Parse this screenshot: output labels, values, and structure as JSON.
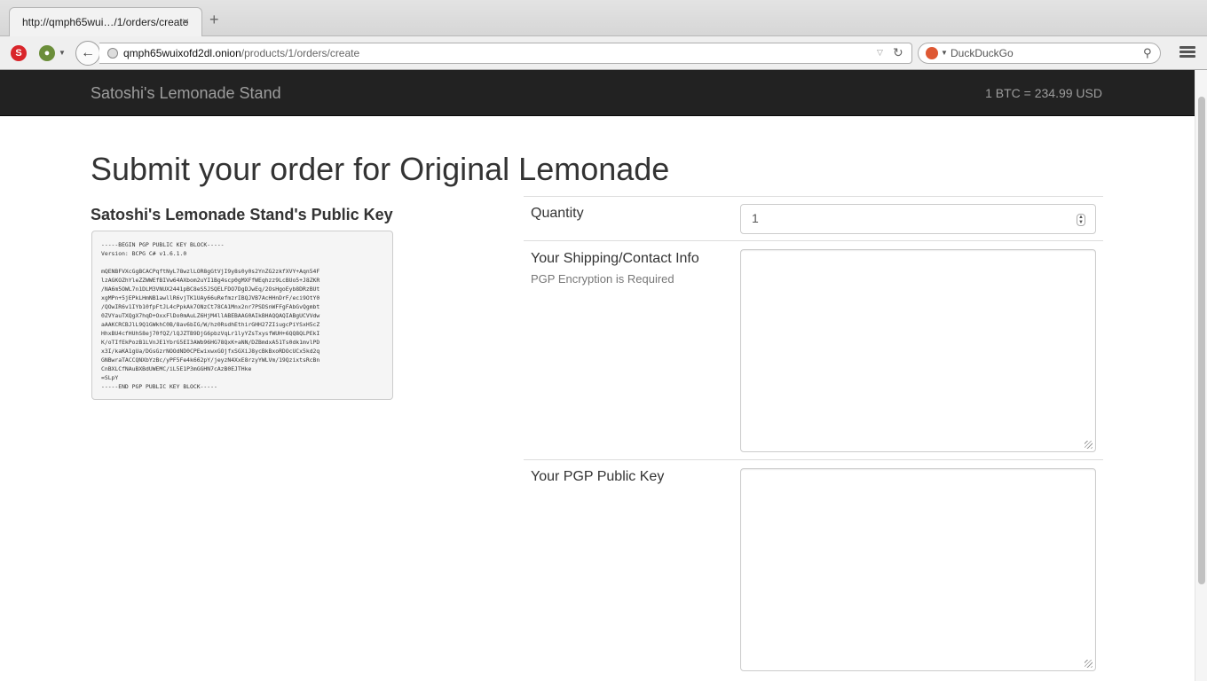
{
  "browser": {
    "tab_title": "http://qmph65wui…/1/orders/create",
    "tab_close": "×",
    "new_tab": "+",
    "url_host": "qmph65wuixofd2dl.onion",
    "url_path": "/products/1/orders/create",
    "search_engine": "DuckDuckGo",
    "reload_glyph": "↻",
    "dropdown_glyph": "▽",
    "back_glyph": "←",
    "search_glyph": "⚲"
  },
  "site": {
    "brand": "Satoshi's Lemonade Stand",
    "rate": "1 BTC = 234.99 USD"
  },
  "page": {
    "title": "Submit your order for Original Lemonade",
    "key_heading": "Satoshi's Lemonade Stand's Public Key",
    "public_key": "-----BEGIN PGP PUBLIC KEY BLOCK-----\nVersion: BCPG C# v1.6.1.0\n\nmQENBFVXcGgBCACPqftNyL78wzlLOR8gGtVjI9y8s0y0s2YnZG2zkfXVY+Aqn54F\nlzAGKOZhYleZZWWEfBIVw64AXbom2uYI1Bg4scp0gMXFfWEqhzz9LcBUo5+J8ZKR\n/NA6m5OWL7n1DLM3VNUX2441pBC8eS5JSQELFDO7DgDJwEq/2OsHgoEyb8DRzBUt\nxgMPn+5jEPkLHmNB1awllR6vjTK1UAy66uRefmzrIBQJVB7AcHHnDrF/eci9OtY0\n/QOwIR6v1IYb10fpFtJL4cPpkAk7ONzCt78CA1Mnx2nr7PSDSnWFFgFAbGvQgmbt\n0ZVYauTXQgX7hqD+OxxFlDo0mAuLZ6HjM4llABEBAAG0AIkBHAQQAQIABgUCVVdw\naAAKCRCBJlL9Q1GWkhC0B/8av6bIG/W/hz0RsdhEthirGHH27ZIiugcPiYSxH5cZ\nHhxBU4cfHUhS8ej70fQZ/lQJZTB9DjG6pbzVqLr1lyYZsTxysfWUH+6QQ8QLPEkI\nK/oTIfEkPozB1LVnJE1YbrG5EI3AWb96HG78QxK+aNN/DZBmdxA51Ts0dk1mvlPD\nx3I/kaKA1gUa/DGsGzrNOOdND0CPEwixwxGOjfxSGXiJ8ycBkBxoRDOcUCx5kd2q\nGNBwraTACCQNXbYzBc/yPF5Fe4k662pY/jeyzN4XxE8rzyYWLVm/19QzixtsRcBn\nCnBXLCfNAuBXBdUWEMC/iL5E1P3mGGHN7cAzB0EJTHke\n=SLpY\n-----END PGP PUBLIC KEY BLOCK-----",
    "quantity_label": "Quantity",
    "quantity_value": "1",
    "shipping_label": "Your Shipping/Contact Info",
    "shipping_sub": "PGP Encryption is Required",
    "pgp_label": "Your PGP Public Key"
  }
}
